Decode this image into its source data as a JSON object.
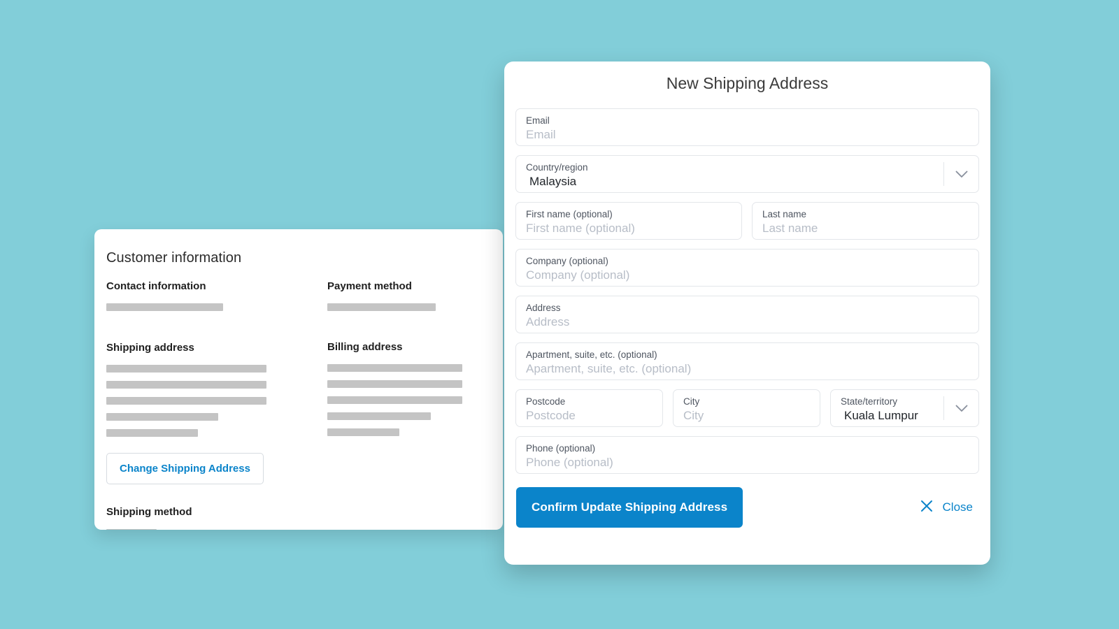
{
  "background_color": "#82ced9",
  "accent_color": "#0b84ca",
  "checkout": {
    "title": "Customer information",
    "sections": {
      "contact": {
        "heading": "Contact information",
        "skeleton_widths": [
          "167px"
        ]
      },
      "payment": {
        "heading": "Payment method",
        "skeleton_widths": [
          "155px"
        ]
      },
      "shipping_address": {
        "heading": "Shipping address",
        "skeleton_widths": [
          "229px",
          "229px",
          "229px",
          "160px",
          "131px"
        ]
      },
      "billing_address": {
        "heading": "Billing address",
        "skeleton_widths": [
          "193px",
          "193px",
          "193px",
          "148px",
          "103px"
        ]
      },
      "shipping_method": {
        "heading": "Shipping method",
        "skeleton_widths": [
          "72px"
        ]
      }
    },
    "change_shipping_address_button": "Change Shipping Address"
  },
  "modal": {
    "title": "New Shipping Address",
    "fields": {
      "email": {
        "label": "Email",
        "placeholder": "Email",
        "value": ""
      },
      "country": {
        "label": "Country/region",
        "value": "Malaysia",
        "type": "select",
        "icon": "chevron-down-icon"
      },
      "first_name": {
        "label": "First name (optional)",
        "placeholder": "First name (optional)",
        "value": ""
      },
      "last_name": {
        "label": "Last name",
        "placeholder": "Last name",
        "value": ""
      },
      "company": {
        "label": "Company (optional)",
        "placeholder": "Company (optional)",
        "value": ""
      },
      "address": {
        "label": "Address",
        "placeholder": "Address",
        "value": ""
      },
      "apartment": {
        "label": "Apartment, suite, etc. (optional)",
        "placeholder": "Apartment, suite, etc. (optional)",
        "value": ""
      },
      "postcode": {
        "label": "Postcode",
        "placeholder": "Postcode",
        "value": ""
      },
      "city": {
        "label": "City",
        "placeholder": "City",
        "value": ""
      },
      "state": {
        "label": "State/territory",
        "value": "Kuala Lumpur",
        "type": "select",
        "icon": "chevron-down-icon"
      },
      "phone": {
        "label": "Phone (optional)",
        "placeholder": "Phone (optional)",
        "value": ""
      }
    },
    "confirm_button": "Confirm Update Shipping Address",
    "close_button": "Close",
    "close_icon": "close-x-icon"
  }
}
